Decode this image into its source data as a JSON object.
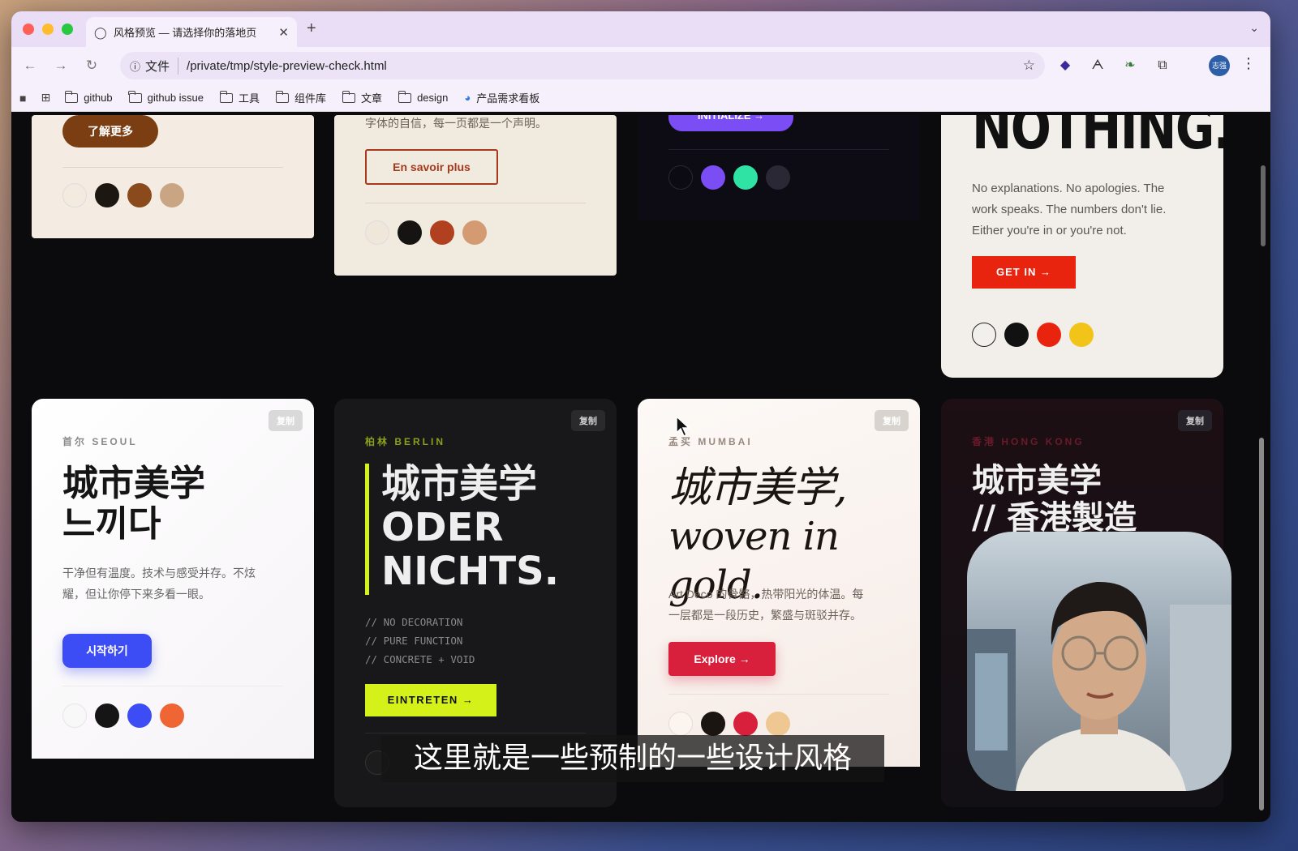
{
  "browser": {
    "tab_title": "风格预览 — 请选择你的落地页",
    "address_scheme": "文件",
    "address_url": "/private/tmp/style-preview-check.html",
    "profile_label": "志强",
    "bookmarks": [
      "github",
      "github issue",
      "工具",
      "组件库",
      "文章",
      "design",
      "产品需求看板"
    ]
  },
  "cards_top": [
    {
      "button": "了解更多",
      "palette": [
        "#f3ebe0",
        "#1c1711",
        "#8a4a1c",
        "#c9a583"
      ]
    },
    {
      "snippet": "字体的自信，每一页都是一个声明。",
      "button": "En savoir plus",
      "palette": [
        "#efe7da",
        "#161412",
        "#b0401f",
        "#d49a72"
      ]
    },
    {
      "button": "INITIALIZE →",
      "palette": [
        "#0c0a12",
        "#7a4df5",
        "#2fe3a4",
        "#2a2834"
      ]
    },
    {
      "headline": "NOTHING.",
      "body": "No explanations. No apologies. The work speaks. The numbers don't lie. Either you're in or you're not.",
      "button": "GET IN →",
      "palette": [
        "#f2f0ec",
        "#111111",
        "#e8240e",
        "#f2c41a"
      ]
    }
  ],
  "cards_bottom": [
    {
      "copy": "复制",
      "eyebrow": "首尔 SEOUL",
      "title_lines": [
        "城市美学",
        "느끼다"
      ],
      "body_lines": [
        "干净但有温度。技术与感受并存。不炫",
        "耀，但让你停下来多看一眼。"
      ],
      "button": "시작하기",
      "palette": [
        "#f8f8f8",
        "#151515",
        "#3d4df5",
        "#ef6534"
      ]
    },
    {
      "copy": "复制",
      "eyebrow": "柏林 BERLIN",
      "title_lines": [
        "城市美学",
        "ODER",
        "NICHTS."
      ],
      "mono_lines": [
        "// NO DECORATION",
        "// PURE FUNCTION",
        "// CONCRETE + VOID"
      ],
      "button": "EINTRETEN →",
      "palette": [
        "#1c1c1c"
      ]
    },
    {
      "copy": "复制",
      "eyebrow": "孟买 MUMBAI",
      "title_lines": [
        "城市美学,",
        "woven in gold."
      ],
      "body_lines": [
        "Art Deco 的骨骼，热带阳光的体温。每",
        "一层都是一段历史，繁盛与斑驳并存。"
      ],
      "button": "Explore →",
      "palette": [
        "#fbf4ef",
        "#1a1511",
        "#d81f3c",
        "#efc792"
      ]
    },
    {
      "copy": "复制",
      "eyebrow": "香港 HONG KONG",
      "title_lines": [
        "城市美学",
        "// 香港製造"
      ]
    }
  ],
  "subtitle": "这里就是一些预制的一些设计风格",
  "colors": {
    "tab_bg": "#e9def6",
    "toolbar_bg": "#f6f0fc",
    "page_bg": "#0b0b0d"
  }
}
